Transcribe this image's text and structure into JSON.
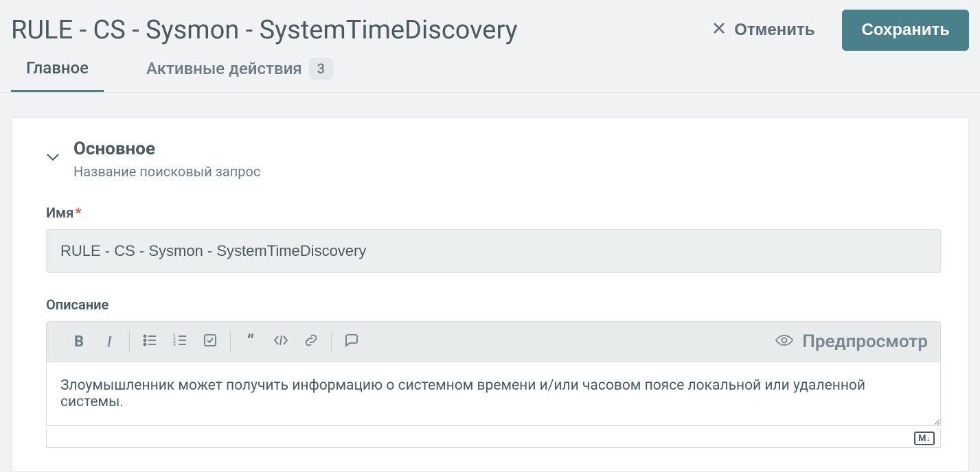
{
  "header": {
    "title": "RULE - CS - Sysmon - SystemTimeDiscovery",
    "cancel_label": "Отменить",
    "save_label": "Сохранить"
  },
  "tabs": {
    "main": "Главное",
    "actions": "Активные действия",
    "actions_count": "3"
  },
  "section": {
    "title": "Основное",
    "subtitle": "Название поисковый запрос"
  },
  "fields": {
    "name_label": "Имя",
    "name_value": "RULE - CS - Sysmon - SystemTimeDiscovery",
    "description_label": "Описание",
    "description_value": "Злоумышленник может получить информацию о системном времени и/или часовом поясе локальной или удаленной системы."
  },
  "editor": {
    "preview_label": "Предпросмотр",
    "markdown_badge": "M↓"
  }
}
